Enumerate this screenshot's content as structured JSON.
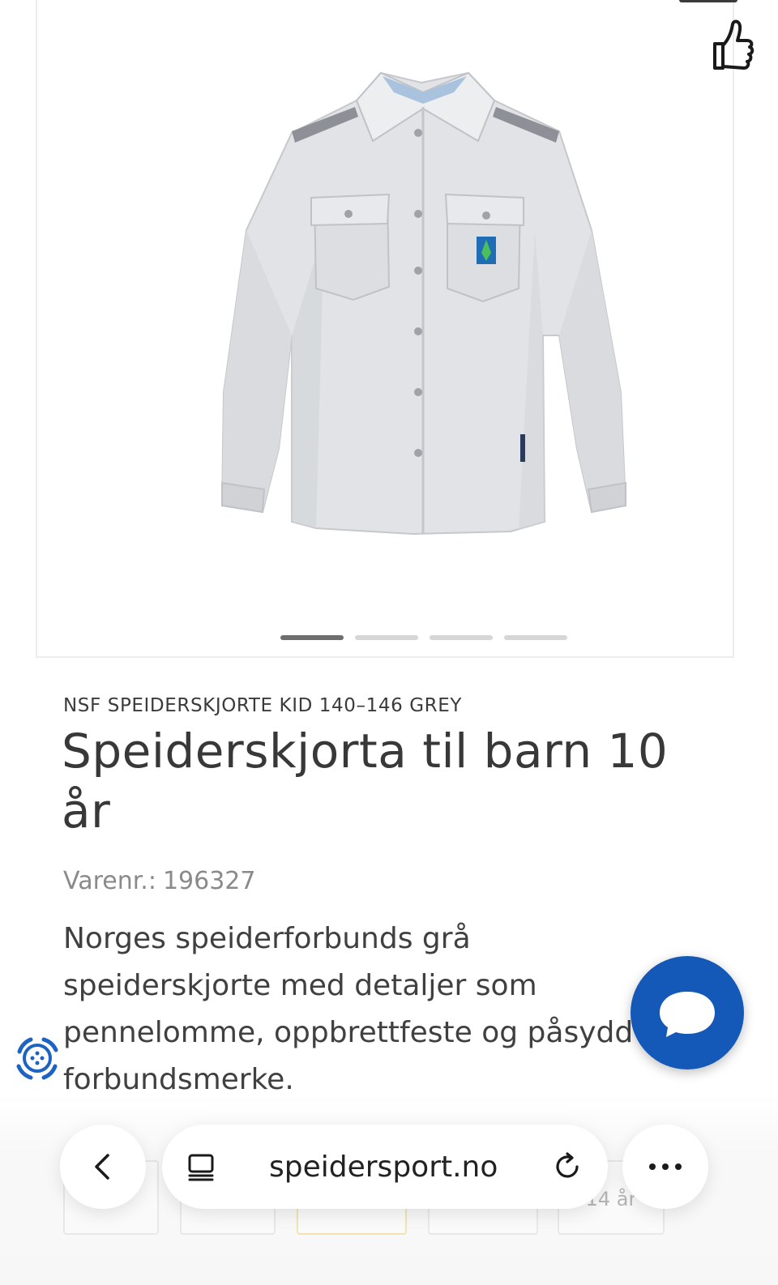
{
  "product": {
    "brand_line": "NSF SPEIDERSKJORTE KID 140–146 GREY",
    "title": "Speiderskjorta til barn 10 år",
    "sku_label": "Varenr.:",
    "sku_value": "196327",
    "description": "Norges speiderforbunds grå speiderskjorte med detaljer som pennelomme, oppbrettfeste og påsydd forbundsmerke."
  },
  "gallery": {
    "image_alt": "Speiderskjorte grå",
    "slide_count": 4,
    "active_slide": 1
  },
  "sizes": {
    "visible_label": "14 år"
  },
  "browser": {
    "url": "speidersport.no"
  },
  "colors": {
    "chat_fab": "#1459b7",
    "text": "#3a3a3a",
    "muted": "#8a8a8a"
  },
  "icons": {
    "thumbs_up": "thumbs-up-icon",
    "chat": "chat-bubble-icon",
    "accessibility": "accessibility-icon",
    "back": "chevron-left-icon",
    "tabs": "tabs-icon",
    "reload": "reload-icon",
    "more": "more-dots-icon"
  }
}
